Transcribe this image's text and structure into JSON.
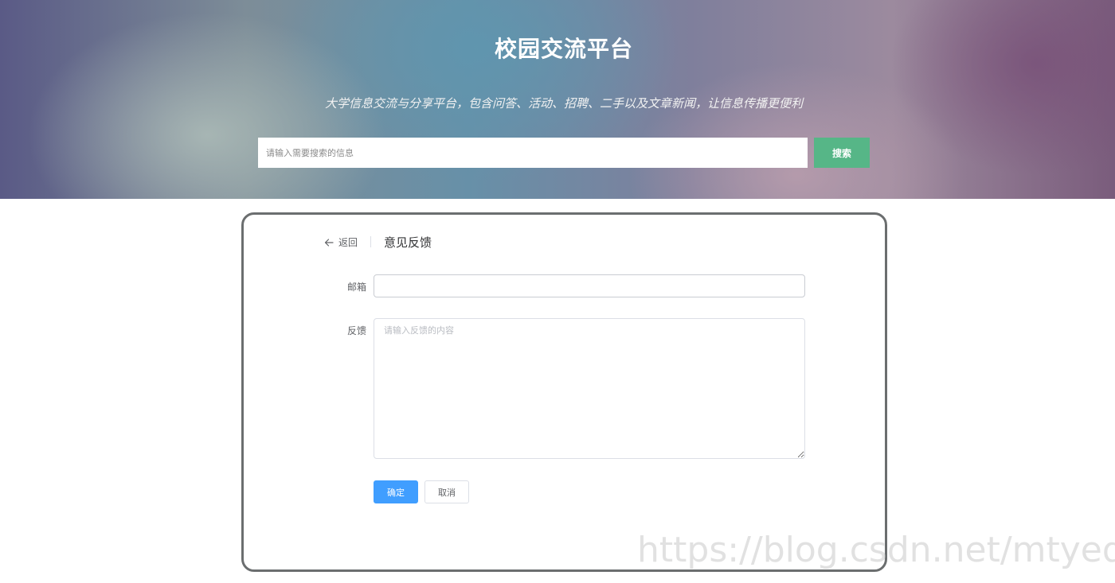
{
  "hero": {
    "title": "校园交流平台",
    "subtitle": "大学信息交流与分享平台，包含问答、活动、招聘、二手以及文章新闻，让信息传播更便利",
    "search_placeholder": "请输入需要搜索的信息",
    "search_button": "搜索"
  },
  "page_header": {
    "back_label": "返回",
    "title": "意见反馈"
  },
  "form": {
    "email_label": "邮箱",
    "email_value": "",
    "feedback_label": "反馈",
    "feedback_placeholder": "请输入反馈的内容",
    "confirm_button": "确定",
    "cancel_button": "取消"
  },
  "watermark": "https://blog.csdn.net/mtyedu",
  "colors": {
    "primary": "#409eff",
    "search_button": "#56b687",
    "card_border": "#6b6e6f"
  },
  "icons": {
    "back": "arrow-left-icon"
  }
}
